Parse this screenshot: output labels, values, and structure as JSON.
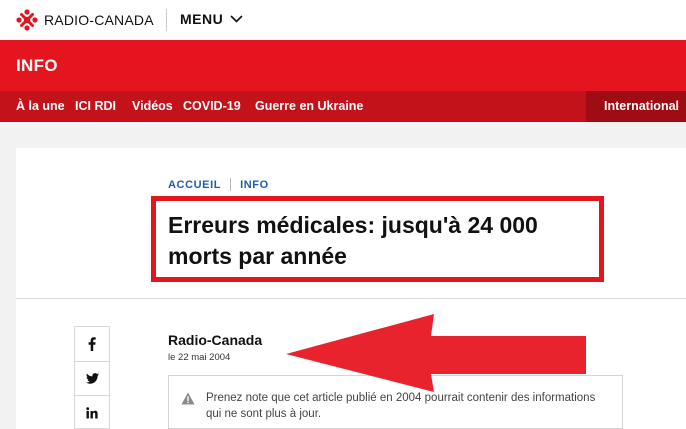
{
  "brand": {
    "logo_text": "RADIO-CANADA",
    "primary_color": "#e4151f"
  },
  "topbar": {
    "menu_label": "MENU"
  },
  "section": {
    "title": "INFO"
  },
  "nav": {
    "items": [
      "À la une",
      "ICI RDI",
      "Vidéos",
      "COVID-19",
      "Guerre en Ukraine"
    ],
    "international": "International"
  },
  "breadcrumb": {
    "home": "ACCUEIL",
    "section": "INFO"
  },
  "article": {
    "headline": "Erreurs médicales: jusqu'à 24 000 morts par année",
    "author": "Radio-Canada",
    "date": "le 22 mai 2004",
    "notice": "Prenez note que cet article publié en 2004 pourrait contenir des informations qui ne sont plus à jour."
  },
  "social": {
    "icons": [
      "facebook-icon",
      "twitter-icon",
      "linkedin-icon"
    ]
  },
  "annotation": {
    "highlight_color": "#e4151f"
  }
}
